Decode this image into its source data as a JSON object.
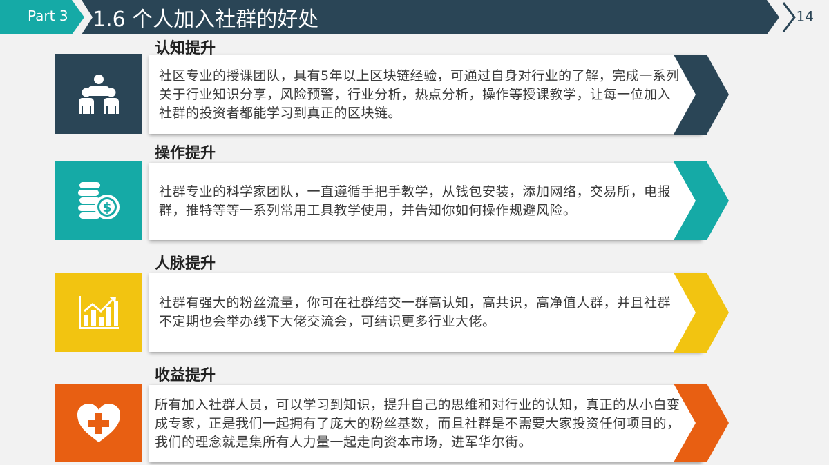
{
  "header": {
    "part_label": "Part 3",
    "title": "1.6 个人加入社群的好处",
    "page_number": "14"
  },
  "colors": {
    "navy": "#2a4556",
    "teal": "#15aaa6",
    "yellow": "#f2c411",
    "orange": "#e85f12"
  },
  "sections": [
    {
      "title": "认知提升",
      "icon": "people-group-icon",
      "text": "社区专业的授课团队，具有5年以上区块链经验，可通过自身对行业的了解，完成一系列关于行业知识分享，风险预警，行业分析，热点分析，操作等授课教学，让每一位加入社群的投资者都能学习到真正的区块链。"
    },
    {
      "title": "操作提升",
      "icon": "coins-dollar-icon",
      "text": "社群专业的科学家团队，一直遵循手把手教学，从钱包安装，添加网络，交易所，电报群，推特等等一系列常用工具教学使用，并告知你如何操作规避风险。"
    },
    {
      "title": "人脉提升",
      "icon": "growth-chart-icon",
      "text": "社群有强大的粉丝流量，你可在社群结交一群高认知，高共识，高净值人群，并且社群不定期也会举办线下大佬交流会，可结识更多行业大佬。"
    },
    {
      "title": "收益提升",
      "icon": "heart-plus-icon",
      "text": "所有加入社群人员，可以学习到知识，提升自己的思维和对行业的认知，真正的从小白变成专家，正是我们一起拥有了庞大的粉丝基数，而且社群是不需要大家投资任何项目的，我们的理念就是集所有人力量一起走向资本市场，进军华尔街。"
    }
  ]
}
